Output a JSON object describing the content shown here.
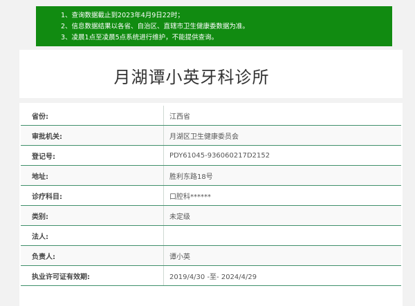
{
  "notice": {
    "lines": [
      "1、查询数据截止到2023年4月9日22时；",
      "2、信息数据结果以各省、自治区、直辖市卫生健康委数据为准。",
      "3、凌晨1点至凌晨5点系统进行维护，不能提供查询。"
    ]
  },
  "page": {
    "title": "月湖谭小英牙科诊所"
  },
  "details": {
    "rows": [
      {
        "label": "省份:",
        "value": "江西省"
      },
      {
        "label": "审批机关:",
        "value": "月湖区卫生健康委员会"
      },
      {
        "label": "登记号:",
        "value": "PDY61045-936060217D2152"
      },
      {
        "label": "地址:",
        "value": "胜利东路18号"
      },
      {
        "label": "诊疗科目:",
        "value": "口腔科******"
      },
      {
        "label": "类别:",
        "value": "未定级"
      },
      {
        "label": "法人:",
        "value": ""
      },
      {
        "label": "负责人:",
        "value": "谭小英"
      },
      {
        "label": "执业许可证有效期:",
        "value": "2019/4/30 -至- 2024/4/29"
      }
    ]
  }
}
